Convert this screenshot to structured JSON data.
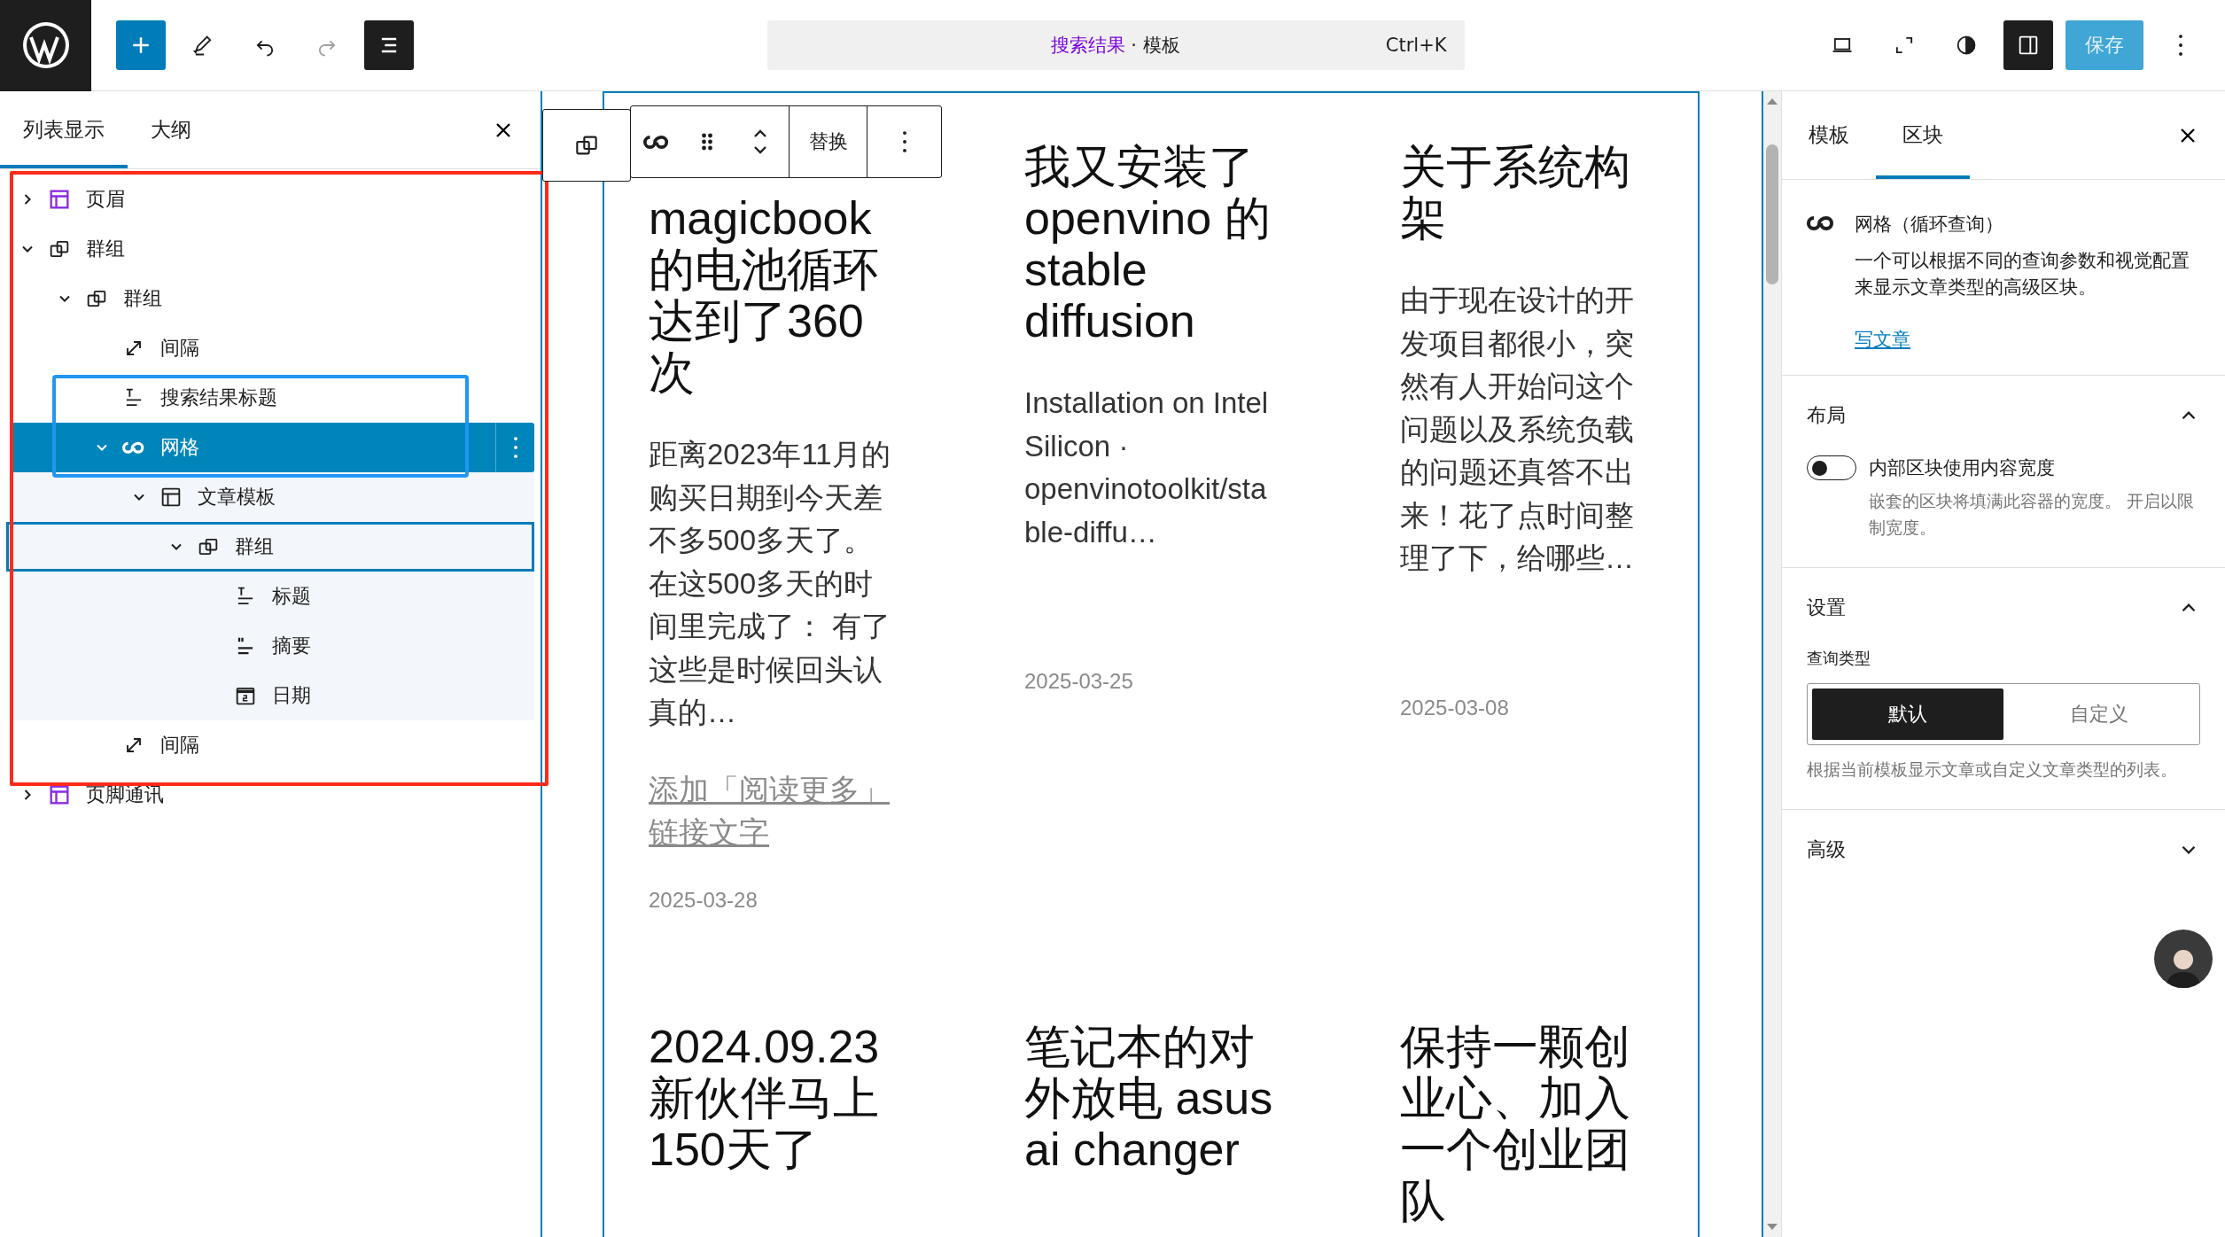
{
  "top_bar": {
    "redo": {
      "disabled": true
    },
    "list_view_toggle": {
      "pressed": true
    },
    "command": {
      "title": "搜索结果",
      "context": "· 模板",
      "shortcut": "Ctrl+K"
    },
    "settings_toggle": {
      "pressed": true
    },
    "save": {
      "label": "保存",
      "disabled": true
    }
  },
  "list_view": {
    "tabs": [
      {
        "label": "列表显示",
        "selected": true
      },
      {
        "label": "大纲",
        "selected": false
      }
    ],
    "tree": [
      {
        "label": "页眉",
        "kind": "header",
        "expanded": false,
        "selected": false
      },
      {
        "label": "群组",
        "kind": "group",
        "expanded": true,
        "selected": false,
        "children": [
          {
            "label": "群组",
            "kind": "group",
            "expanded": true,
            "selected": false,
            "children": [
              {
                "label": "间隔",
                "kind": "spacer",
                "selected": false
              },
              {
                "label": "搜索结果标题",
                "kind": "heading",
                "selected": false
              },
              {
                "label": "网格",
                "kind": "query",
                "expanded": true,
                "selected": true,
                "children": [
                  {
                    "label": "文章模板",
                    "kind": "template",
                    "expanded": true,
                    "selected": false,
                    "children": [
                      {
                        "label": "群组",
                        "kind": "group",
                        "expanded": true,
                        "selected": false,
                        "focused": true,
                        "children": [
                          {
                            "label": "标题",
                            "kind": "heading",
                            "selected": false
                          },
                          {
                            "label": "摘要",
                            "kind": "excerpt",
                            "selected": false
                          },
                          {
                            "label": "日期",
                            "kind": "date",
                            "selected": false
                          }
                        ]
                      }
                    ]
                  }
                ]
              },
              {
                "label": "间隔",
                "kind": "spacer",
                "selected": false
              }
            ]
          }
        ]
      },
      {
        "label": "页脚通讯",
        "kind": "header",
        "expanded": false,
        "selected": false
      }
    ]
  },
  "canvas": {
    "block_toolbar": {
      "replace": "替换"
    },
    "posts": [
      {
        "title": "magicbook的电池循环达到了360次",
        "excerpt": "距离2023年11月的购买日期到今天差不多500多天了。在这500多天的时间里完成了： 有了这些是时候回头认真的…",
        "read_more": "添加「阅读更多」链接文字",
        "date": "2025-03-28"
      },
      {
        "title": "我又安装了openvino 的stable diffusion",
        "excerpt": "Installation on Intel Silicon · openvinotoolkit/stable-diffu…",
        "date": "2025-03-25"
      },
      {
        "title": "关于系统构架",
        "excerpt": "由于现在设计的开发项目都很小，突然有人开始问这个问题以及系统负载的问题还真答不出来！花了点时间整理了下，给哪些…",
        "date": "2025-03-08"
      },
      {
        "title": "2024.09.23 新伙伴马上150天了"
      },
      {
        "title": "笔记本的对外放电 asus ai changer"
      },
      {
        "title": "保持一颗创业心、加入一个创业团队"
      }
    ]
  },
  "sidebar": {
    "tabs": [
      {
        "label": "模板",
        "selected": false
      },
      {
        "label": "区块",
        "selected": true
      }
    ],
    "block": {
      "title": "网格（循环查询）",
      "description": "一个可以根据不同的查询参数和视觉配置来显示文章类型的高级区块。",
      "link": "写文章"
    },
    "panels": [
      {
        "kind": "layout",
        "title": "布局",
        "expanded": true,
        "toggle": {
          "label": "内部区块使用内容宽度",
          "on": false,
          "help": "嵌套的区块将填满此容器的宽度。 开启以限制宽度。"
        }
      },
      {
        "kind": "settings",
        "title": "设置",
        "expanded": true,
        "field_label": "查询类型",
        "options": [
          {
            "label": "默认",
            "selected": true
          },
          {
            "label": "自定义",
            "selected": false
          }
        ],
        "help": "根据当前模板显示文章或自定义文章类型的列表。"
      },
      {
        "kind": "advanced",
        "title": "高级",
        "expanded": false
      }
    ]
  }
}
